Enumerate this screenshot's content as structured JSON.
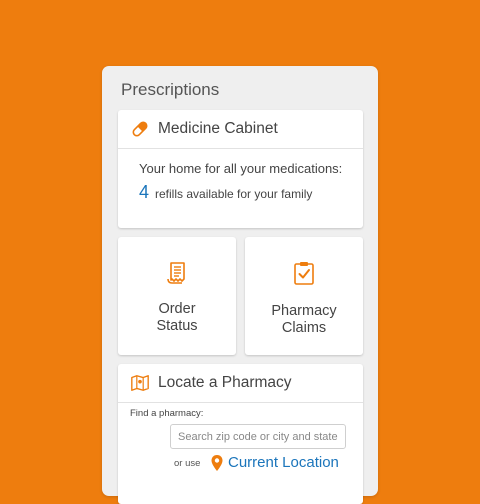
{
  "colors": {
    "background": "#EE7D0E",
    "accent": "#EE7D0E",
    "link": "#1B75BB"
  },
  "panel": {
    "title": "Prescriptions"
  },
  "cabinet": {
    "icon": "pill-icon",
    "title": "Medicine Cabinet",
    "line1": "Your home for all your medications:",
    "refill_count": "4",
    "refill_text": "refills available for your family"
  },
  "tiles": [
    {
      "icon": "receipt-icon",
      "label_line1": "Order",
      "label_line2": "Status"
    },
    {
      "icon": "clipboard-check-icon",
      "label_line1": "Pharmacy",
      "label_line2": "Claims"
    }
  ],
  "locate": {
    "icon": "map-icon",
    "title": "Locate a Pharmacy",
    "find_label": "Find a pharmacy:",
    "search_placeholder": "Search zip code or city and state",
    "or_use": "or use",
    "pin_icon": "location-pin-icon",
    "current_location": "Current Location"
  }
}
